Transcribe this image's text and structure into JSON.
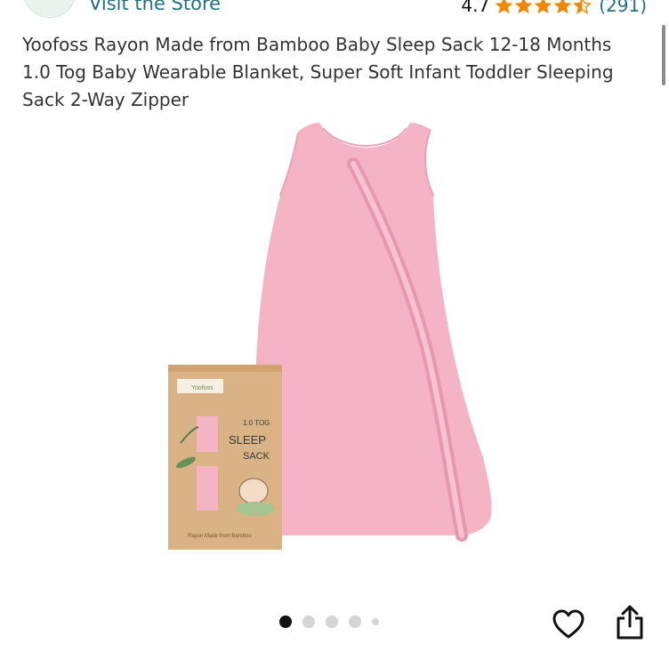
{
  "store": {
    "link_label": "Visit the Store",
    "logo_icon": "brand-logo-icon"
  },
  "rating": {
    "value": "4.7",
    "stars": 4.5,
    "count": "(291)",
    "star_color": "#f08804"
  },
  "product": {
    "title": "Yoofoss Rayon Made from Bamboo Baby Sleep Sack 12-18 Months 1.0 Tog Baby Wearable Blanket, Super Soft Infant Toddler Sleeping Sack 2-Way Zipper",
    "image_colors": {
      "sack": "#f5b3c6",
      "box": "#d9b386"
    },
    "box_text": {
      "brand": "Yoofoss",
      "tog": "1.0 TOG",
      "line1": "SLEEP",
      "line2": "SACK",
      "footer": "Rayon Made from Bamboo"
    }
  },
  "carousel": {
    "image_count": 5,
    "active_index": 0
  },
  "actions": {
    "wishlist_icon": "heart-icon",
    "share_icon": "share-icon"
  }
}
